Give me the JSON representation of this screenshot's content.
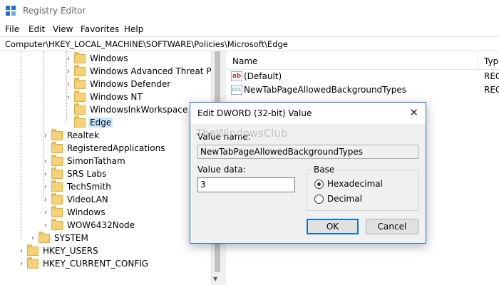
{
  "window": {
    "title": "Registry Editor"
  },
  "menu": [
    "File",
    "Edit",
    "View",
    "Favorites",
    "Help"
  ],
  "address": "Computer\\HKEY_LOCAL_MACHINE\\SOFTWARE\\Policies\\Microsoft\\Edge",
  "tree": [
    {
      "label": "Windows",
      "chevron": "›"
    },
    {
      "label": "Windows Advanced Threat Prote",
      "chevron": "›"
    },
    {
      "label": "Windows Defender",
      "chevron": "›"
    },
    {
      "label": "Windows NT",
      "chevron": "›"
    },
    {
      "label": "WindowsInkWorkspace",
      "chevron": ""
    },
    {
      "label": "Edge",
      "chevron": "",
      "selected": true
    },
    {
      "label": "Realtek",
      "chevron": "›"
    },
    {
      "label": "RegisteredApplications",
      "chevron": ""
    },
    {
      "label": "SimonTatham",
      "chevron": "›"
    },
    {
      "label": "SRS Labs",
      "chevron": "›"
    },
    {
      "label": "TechSmith",
      "chevron": "›"
    },
    {
      "label": "VideoLAN",
      "chevron": "›"
    },
    {
      "label": "Windows",
      "chevron": "›"
    },
    {
      "label": "WOW6432Node",
      "chevron": "›"
    },
    {
      "label": "SYSTEM",
      "chevron": "›"
    },
    {
      "label": "HKEY_USERS",
      "chevron": "›"
    },
    {
      "label": "HKEY_CURRENT_CONFIG",
      "chevron": "›"
    }
  ],
  "values_pane": {
    "columns": {
      "name": "Name",
      "type": "Type"
    },
    "rows": [
      {
        "icon": "string-value-icon",
        "name": "(Default)",
        "type": "REG"
      },
      {
        "icon": "dword-value-icon",
        "name": "NewTabPageAllowedBackgroundTypes",
        "type": "REG"
      }
    ]
  },
  "dialog": {
    "title": "Edit DWORD (32-bit) Value",
    "close_glyph": "✕",
    "value_name_label": "Value name:",
    "value_name": "NewTabPageAllowedBackgroundTypes",
    "value_data_label": "Value data:",
    "value_data": "3",
    "base_label": "Base",
    "base_options": [
      {
        "label": "Hexadecimal",
        "selected": true
      },
      {
        "label": "Decimal",
        "selected": false
      }
    ],
    "ok_label": "OK",
    "cancel_label": "Cancel"
  },
  "watermark": "TheWindowsClub",
  "colors": {
    "selection": "#cce8ff",
    "accent": "#0078d7",
    "folder": "#f5d17a"
  }
}
